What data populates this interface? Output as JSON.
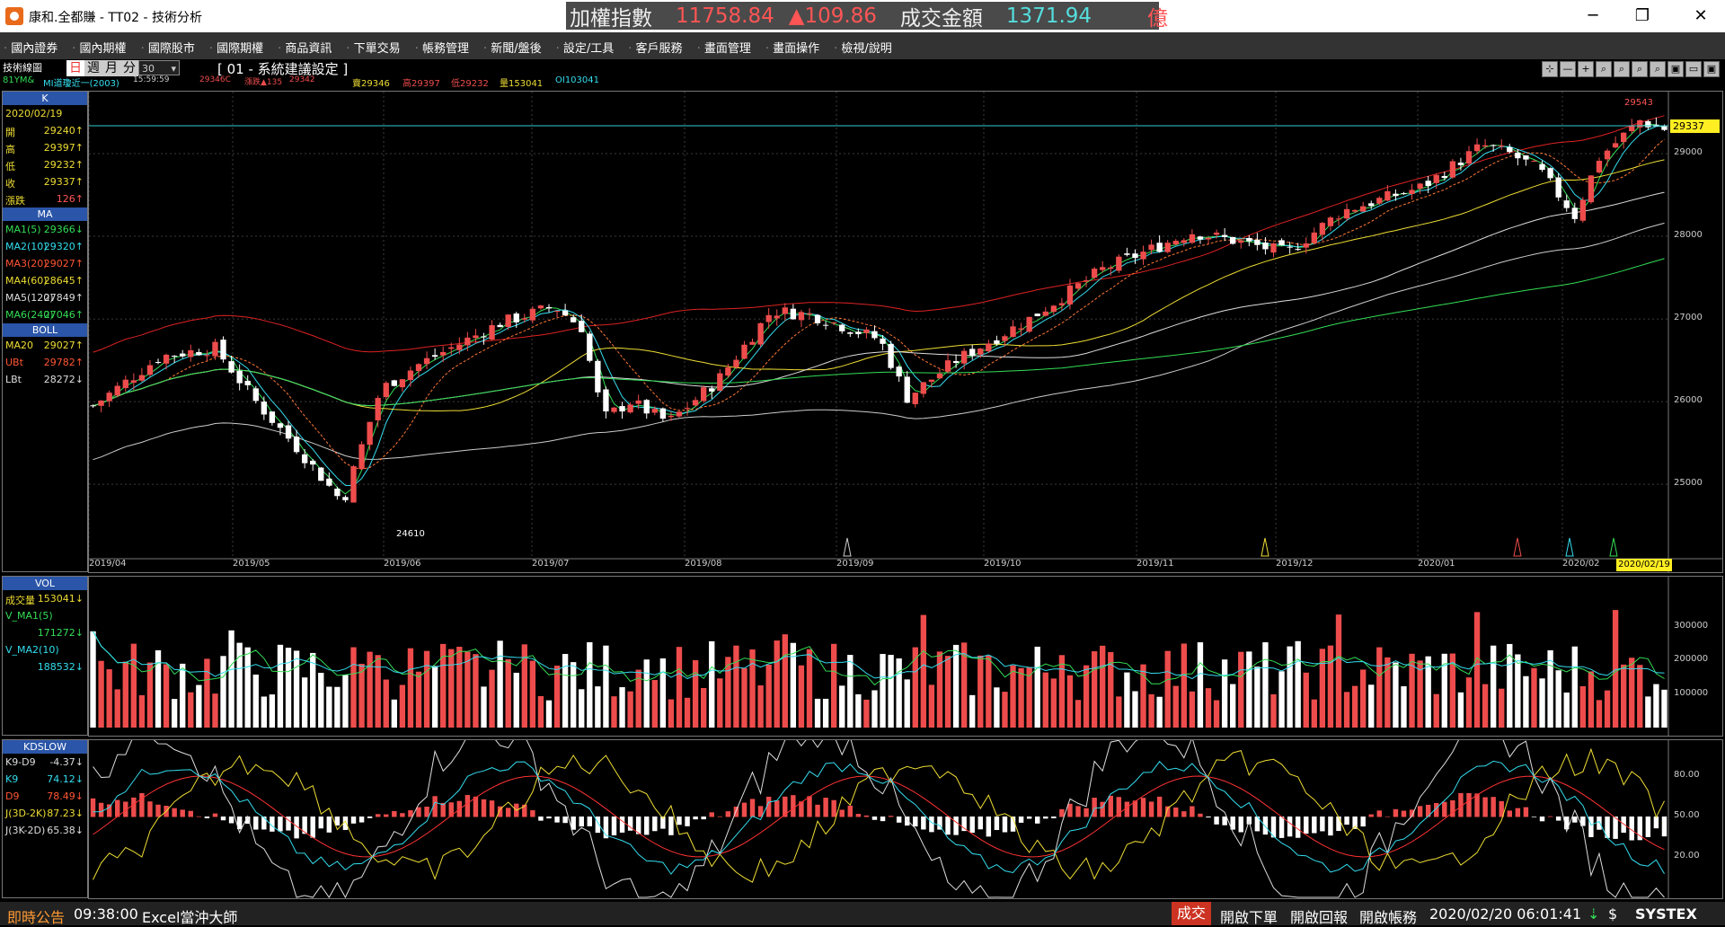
{
  "window": {
    "title": "康和.全都賺 - TT02 - 技術分析",
    "minimize": "─",
    "maximize": "❐",
    "close": "✕"
  },
  "ticker": {
    "label": "加權指數",
    "value": "11758.84",
    "change": "▲109.86",
    "turnover_label": "成交金額",
    "turnover": "1371.94",
    "unit": "億"
  },
  "menu": [
    "國內證券",
    "國內期權",
    "國際股市",
    "國際期權",
    "商品資訊",
    "下單交易",
    "帳務管理",
    "新聞/盤後",
    "設定/工具",
    "客戶服務",
    "畫面管理",
    "畫面操作",
    "檢視/說明"
  ],
  "toolbar": {
    "tab": "技術線圖",
    "symbol": "81YM&",
    "contract": "MI道瓊近一(2003)",
    "time": "15:59:59",
    "p1": "29346C",
    "p2": "漲跌▲135",
    "p3": "29342",
    "buy": "賣29346",
    "high": "高29397",
    "low": "低29232",
    "vol": "量153041",
    "oi": "OI103041",
    "periods": [
      "日",
      "週",
      "月",
      "分"
    ],
    "period_value": "30",
    "setting": "[ 01 - 系統建議設定 ]",
    "tool_icons": [
      "⊹",
      "—",
      "+",
      "⌕",
      "⌕",
      "⌕",
      "⌕",
      "▣",
      "▭",
      "▣"
    ]
  },
  "panel_k": {
    "head": "K",
    "date": "2020/02/19",
    "rows": [
      {
        "k": "開",
        "v": "29240↑"
      },
      {
        "k": "高",
        "v": "29397↑"
      },
      {
        "k": "低",
        "v": "29232↑"
      },
      {
        "k": "收",
        "v": "29337↑"
      },
      {
        "k": "漲跌",
        "v": "126↑"
      }
    ]
  },
  "panel_ma": {
    "head": "MA",
    "rows": [
      {
        "k": "MA1(5)",
        "v": "29366↓",
        "c": "#33dd55"
      },
      {
        "k": "MA2(10)",
        "v": "29320↑",
        "c": "#33ddee"
      },
      {
        "k": "MA3(20)",
        "v": "29027↑",
        "c": "#ff5533"
      },
      {
        "k": "MA4(60)",
        "v": "28645↑",
        "c": "#eedd33"
      },
      {
        "k": "MA5(120)",
        "v": "27849↑",
        "c": "#dddddd"
      },
      {
        "k": "MA6(240)",
        "v": "27046↑",
        "c": "#33dd55"
      }
    ]
  },
  "panel_boll": {
    "head": "BOLL",
    "rows": [
      {
        "k": "MA20",
        "v": "29027↑",
        "c": "#eedd33"
      },
      {
        "k": "UBt",
        "v": "29782↑",
        "c": "#ff5533"
      },
      {
        "k": "LBt",
        "v": "28272↓",
        "c": "#dddddd"
      }
    ]
  },
  "panel_vol": {
    "head": "VOL",
    "rows": [
      {
        "k": "成交量",
        "v": "153041↓",
        "c": "#eedd33"
      },
      {
        "k": "V_MA1(5)",
        "v": "",
        "c": "#33dd55"
      },
      {
        "k": "",
        "v": "171272↓",
        "c": "#33dd55"
      },
      {
        "k": "V_MA2(10)",
        "v": "",
        "c": "#33ddee"
      },
      {
        "k": "",
        "v": "188532↓",
        "c": "#33ddee"
      }
    ]
  },
  "panel_kd": {
    "head": "KDSLOW",
    "rows": [
      {
        "k": "K9-D9",
        "v": "-4.37↓",
        "c": "#dddddd"
      },
      {
        "k": "K9",
        "v": "74.12↓",
        "c": "#33ddee"
      },
      {
        "k": "D9",
        "v": "78.49↓",
        "c": "#ff5533"
      },
      {
        "k": "J(3D-2K)",
        "v": "87.23↓",
        "c": "#eedd33"
      },
      {
        "k": "J(3K-2D)",
        "v": "65.38↓",
        "c": "#dddddd"
      }
    ]
  },
  "chart_data": {
    "type": "candlestick",
    "price_ticks": [
      "29000",
      "28000",
      "27000",
      "26000",
      "25000"
    ],
    "price_ylim": [
      24100,
      29750
    ],
    "months": [
      "2019/04",
      "2019/05",
      "2019/06",
      "2019/07",
      "2019/08",
      "2019/09",
      "2019/10",
      "2019/11",
      "2019/12",
      "2020/01",
      "2020/02"
    ],
    "current_price_label": "29337",
    "current_price": 29337,
    "high_label": "29543",
    "low_label": "24610",
    "date_label": "2020/02/19",
    "vol_ticks": [
      "300000",
      "200000",
      "100000"
    ],
    "vol_ylim": [
      0,
      400000
    ],
    "kd_ticks": [
      "80.00",
      "50.00",
      "20.00"
    ],
    "kd_ylim": [
      0,
      100
    ]
  },
  "status": {
    "announce": "即時公告",
    "time": "09:38:00",
    "ad": "Excel當沖大師",
    "trade": "成交",
    "open_order": "開啟下單",
    "open_return": "開啟回報",
    "open_account": "開啟帳務",
    "datetime": "2020/02/20 06:01:41",
    "brand": "SYSTEX"
  },
  "colors": {
    "up": "#ee4c4c",
    "down": "#ffffff",
    "panel_head": "#2a55a8",
    "accent_yellow": "#eedd33"
  }
}
